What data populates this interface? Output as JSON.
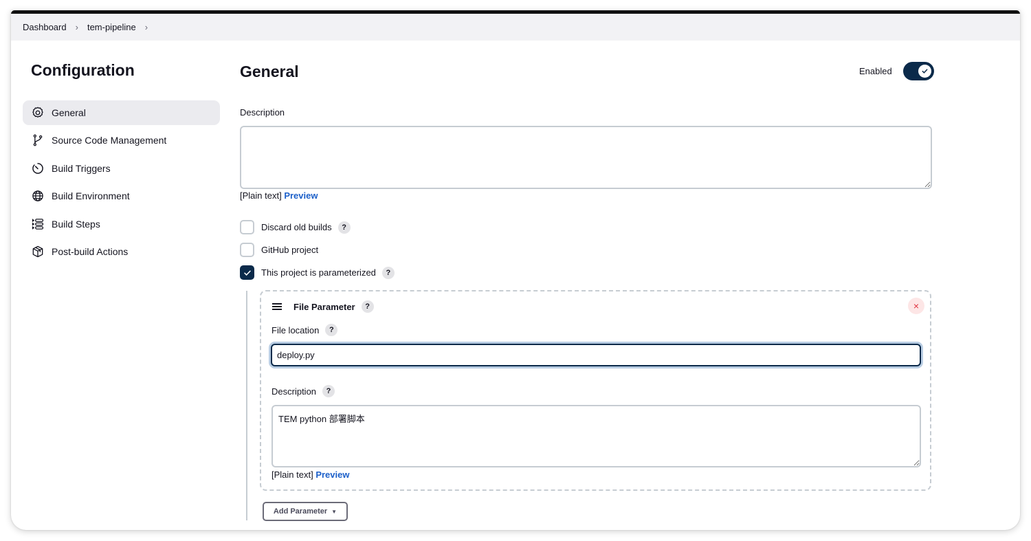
{
  "breadcrumb": [
    {
      "label": "Dashboard"
    },
    {
      "label": "tem-pipeline"
    }
  ],
  "sidebar": {
    "title": "Configuration",
    "items": [
      {
        "label": "General",
        "icon": "gear-icon",
        "active": true
      },
      {
        "label": "Source Code Management",
        "icon": "branch-icon",
        "active": false
      },
      {
        "label": "Build Triggers",
        "icon": "timer-icon",
        "active": false
      },
      {
        "label": "Build Environment",
        "icon": "globe-icon",
        "active": false
      },
      {
        "label": "Build Steps",
        "icon": "list-steps-icon",
        "active": false
      },
      {
        "label": "Post-build Actions",
        "icon": "package-icon",
        "active": false
      }
    ]
  },
  "main": {
    "title": "General",
    "enabled_label": "Enabled",
    "enabled": true,
    "description": {
      "label": "Description",
      "value": "",
      "hint_prefix": "[Plain text]",
      "preview_label": "Preview"
    },
    "options": [
      {
        "label": "Discard old builds",
        "checked": false,
        "help": "?"
      },
      {
        "label": "GitHub project",
        "checked": false
      },
      {
        "label": "This project is parameterized",
        "checked": true,
        "help": "?"
      }
    ],
    "parameter": {
      "title": "File Parameter",
      "help": "?",
      "close_icon": "×",
      "file_location_label": "File location",
      "file_location_value": "deploy.py",
      "description_label": "Description",
      "description_value": "TEM python 部署脚本",
      "hint_prefix": "[Plain text]",
      "preview_label": "Preview"
    },
    "add_parameter_label": "Add Parameter"
  },
  "colors": {
    "accent_dark": "#0b2a4a",
    "link": "#1b5fc9",
    "danger": "#e0323e"
  }
}
